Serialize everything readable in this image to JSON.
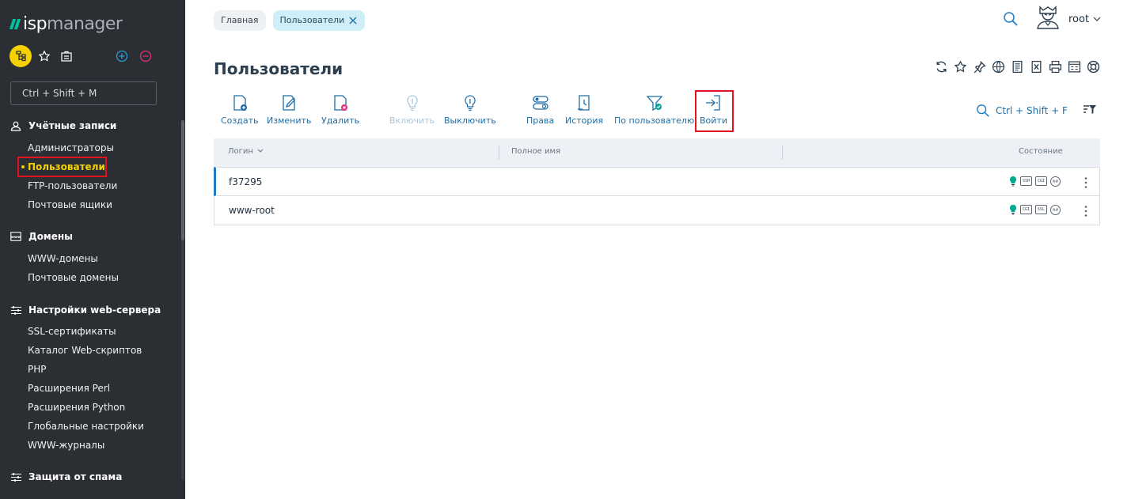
{
  "app": {
    "logo_isp": "isp",
    "logo_manager": "manager"
  },
  "sidebar": {
    "search_placeholder": "Ctrl + Shift + M",
    "groups": [
      {
        "label": "Учётные записи",
        "icon": "user-icon",
        "items": [
          "Администраторы",
          "Пользователи",
          "FTP-пользователи",
          "Почтовые ящики"
        ]
      },
      {
        "label": "Домены",
        "icon": "www-icon",
        "items": [
          "WWW-домены",
          "Почтовые домены"
        ]
      },
      {
        "label": "Настройки web-сервера",
        "icon": "sliders-icon",
        "items": [
          "SSL-сертификаты",
          "Каталог Web-скриптов",
          "PHP",
          "Расширения Perl",
          "Расширения Python",
          "Глобальные настройки",
          "WWW-журналы"
        ]
      },
      {
        "label": "Защита от спама",
        "icon": "sliders-icon",
        "items": []
      }
    ],
    "active_item": "Пользователи"
  },
  "breadcrumbs": {
    "home": "Главная",
    "current": "Пользователи"
  },
  "user": {
    "name": "root"
  },
  "page": {
    "title": "Пользователи"
  },
  "toolbar": {
    "create": "Создать",
    "edit": "Изменить",
    "delete": "Удалить",
    "enable": "Включить",
    "disable": "Выключить",
    "rights": "Права",
    "history": "История",
    "by_user": "По пользователю",
    "login": "Войти",
    "search_hint": "Ctrl + Shift + F"
  },
  "table": {
    "columns": {
      "login": "Логин",
      "fullname": "Полное имя",
      "status": "Состояние"
    },
    "rows": [
      {
        "login": "f37295",
        "badges": [
          "SSH",
          "CGI",
          "PHP"
        ]
      },
      {
        "login": "www-root",
        "badges": [
          "CGI",
          "SSL",
          "PHP"
        ]
      }
    ]
  },
  "colors": {
    "sidebar_bg": "#2b2e33",
    "accent_blue": "#1e6ea8",
    "highlight_red": "#e0141e",
    "active_yellow": "#f5d100",
    "teal": "#00a88f"
  }
}
